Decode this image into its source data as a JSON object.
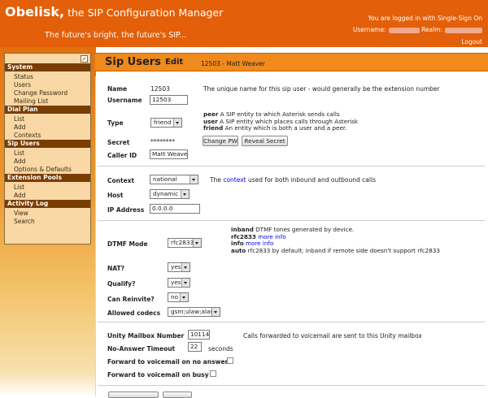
{
  "header": {
    "brand_name": "Obelisk,",
    "brand_rest": "the SIP Configuration Manager",
    "tagline": "The future's bright, the future's SIP...",
    "login_text": "You are logged in with Single-Sign On",
    "username_label": "Username:",
    "realm_label": "Realm:",
    "logout": "Logout"
  },
  "sidebar": {
    "sections": [
      {
        "title": "System",
        "items": [
          "Status",
          "Users",
          "Change Password",
          "Mailing List"
        ]
      },
      {
        "title": "Dial Plan",
        "items": [
          "List",
          "Add",
          "Contexts"
        ]
      },
      {
        "title": "Sip Users",
        "items": [
          "List",
          "Add",
          "Options & Defaults"
        ]
      },
      {
        "title": "Extension Pools",
        "items": [
          "List",
          "Add"
        ]
      },
      {
        "title": "Activity Log",
        "items": [
          "View",
          "Search"
        ]
      }
    ]
  },
  "page": {
    "title": "Sip Users",
    "action": "Edit",
    "subtitle": "12503 - Matt Weaver"
  },
  "form": {
    "name_label": "Name",
    "name_value": "12503",
    "name_desc": "The unique name for this sip user - would generally be the extension number",
    "username_label": "Username",
    "username_value": "12503",
    "type_label": "Type",
    "type_value": "friend",
    "type_desc": [
      {
        "key": "peer",
        "text": "A SIP entity to which Asterisk sends calls"
      },
      {
        "key": "user",
        "text": "A SIP entity which places calls through Asterisk"
      },
      {
        "key": "friend",
        "text": "An entity which is both a user and a peer."
      }
    ],
    "secret_label": "Secret",
    "secret_value": "********",
    "change_pw": "Change PW",
    "reveal_secret": "Reveal Secret",
    "callerid_label": "Caller ID",
    "callerid_value": "Matt Weaver",
    "context_label": "Context",
    "context_value": "national",
    "context_desc_pre": "The",
    "context_desc_link": "context",
    "context_desc_post": "used for both inbound and outbound calls",
    "host_label": "Host",
    "host_value": "dynamic",
    "ip_label": "IP Address",
    "ip_value": "0.0.0.0",
    "dtmf_label": "DTMF Mode",
    "dtmf_value": "rfc2833",
    "dtmf_desc": {
      "inband_key": "inband",
      "inband_text": "DTMF tones generated by device.",
      "rfc_key": "rfc2833",
      "more": "more info",
      "info_key": "info",
      "auto_key": "auto",
      "auto_text": "rfc2833 by default; inband if remote side doesn't support rfc2833"
    },
    "nat_label": "NAT?",
    "nat_value": "yes",
    "qualify_label": "Qualify?",
    "qualify_value": "yes",
    "reinvite_label": "Can Reinvite?",
    "reinvite_value": "no",
    "codecs_label": "Allowed codecs",
    "codecs_value": "gsm;ulaw;alaw",
    "mailbox_label": "Unity Mailbox Number",
    "mailbox_value": "10114",
    "mailbox_desc": "Calls forwarded to voicemail are sent to this Unity mailbox",
    "timeout_label": "No-Answer Timeout",
    "timeout_value": "22",
    "timeout_unit": "seconds",
    "fwd_noanswer_label": "Forward to voicemail on no answer",
    "fwd_noanswer_checked": false,
    "fwd_busy_label": "Forward to voicemail on busy",
    "fwd_busy_checked": false
  }
}
